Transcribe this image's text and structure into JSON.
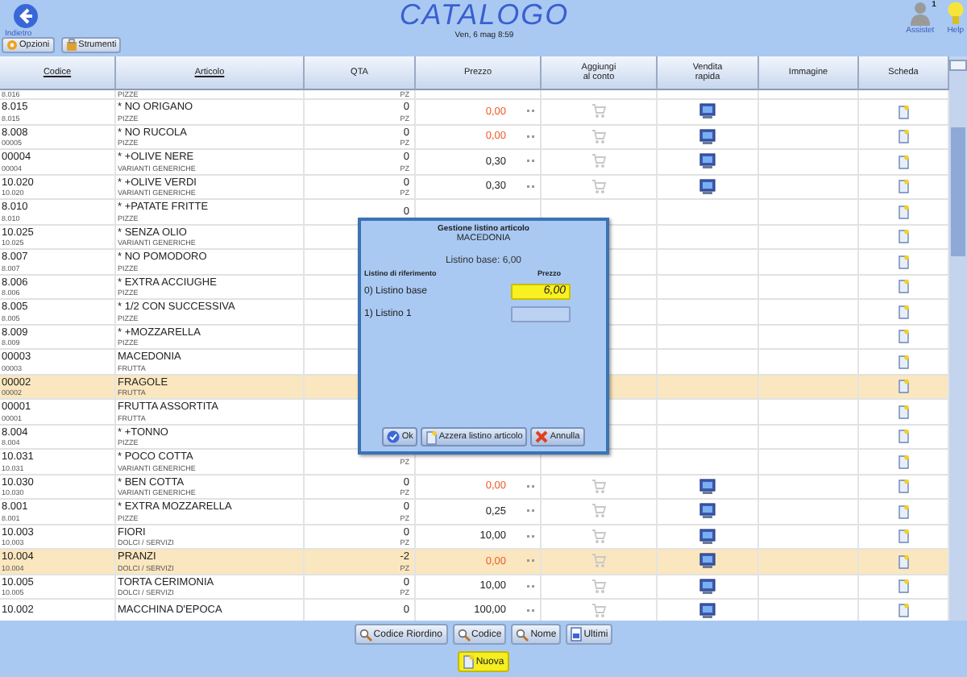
{
  "header": {
    "back_label": "Indietro",
    "title": "CATALOGO",
    "datetime": "Ven, 6 mag 8:59",
    "assistant_label": "Assistet",
    "assistant_badge": "1",
    "help_label": "Help"
  },
  "toolbar": [
    {
      "label": "Opzioni",
      "kind": "options"
    },
    {
      "label": "Strumenti",
      "kind": "tools"
    }
  ],
  "table": {
    "columns": [
      {
        "label": "Codice",
        "sortable": true
      },
      {
        "label": "Articolo",
        "sortable": true
      },
      {
        "label": "QTA",
        "sortable": false
      },
      {
        "label": "Prezzo",
        "sortable": false
      },
      {
        "label": "Aggiungi\nal conto",
        "sortable": false
      },
      {
        "label": "Vendita\nrapida",
        "sortable": false
      },
      {
        "label": "Immagine",
        "sortable": false
      },
      {
        "label": "Scheda",
        "sortable": false
      }
    ],
    "rows": [
      {
        "kind": "lower",
        "highlighted": false,
        "code_sub": "8.016",
        "category": "PIZZE",
        "unit": "PZ"
      },
      {
        "kind": "full",
        "highlighted": false,
        "code": "8.015",
        "code_sub": "8.015",
        "name": "* NO ORIGANO",
        "category": "PIZZE",
        "qty": "0",
        "unit": "PZ",
        "price": "0,00",
        "price_alert": true
      },
      {
        "kind": "full",
        "highlighted": false,
        "code": "8.008",
        "code_sub": "00005",
        "name": "* NO RUCOLA",
        "category": "PIZZE",
        "qty": "0",
        "unit": "PZ",
        "price": "0,00",
        "price_alert": true
      },
      {
        "kind": "full",
        "highlighted": false,
        "code": "00004",
        "code_sub": "00004",
        "name": "* +OLIVE NERE",
        "category": "VARIANTI GENERICHE",
        "qty": "0",
        "unit": "PZ",
        "price": "0,30",
        "price_alert": false
      },
      {
        "kind": "full",
        "highlighted": false,
        "code": "10.020",
        "code_sub": "10.020",
        "name": "* +OLIVE VERDI",
        "category": "VARIANTI GENERICHE",
        "qty": "0",
        "unit": "PZ",
        "price": "0,30",
        "price_alert": false
      },
      {
        "kind": "full",
        "highlighted": false,
        "code": "8.010",
        "code_sub": "8.010",
        "name": "* +PATATE FRITTE",
        "category": "PIZZE",
        "qty": "0"
      },
      {
        "kind": "full",
        "highlighted": false,
        "code": "10.025",
        "code_sub": "10.025",
        "name": "* SENZA OLIO",
        "category": "VARIANTI GENERICHE"
      },
      {
        "kind": "full",
        "highlighted": false,
        "code": "8.007",
        "code_sub": "8.007",
        "name": "* NO POMODORO",
        "category": "PIZZE"
      },
      {
        "kind": "full",
        "highlighted": false,
        "code": "8.006",
        "code_sub": "8.006",
        "name": "* EXTRA ACCIUGHE",
        "category": "PIZZE"
      },
      {
        "kind": "full",
        "highlighted": false,
        "code": "8.005",
        "code_sub": "8.005",
        "name": "* 1/2 CON SUCCESSIVA",
        "category": "PIZZE"
      },
      {
        "kind": "full",
        "highlighted": false,
        "code": "8.009",
        "code_sub": "8.009",
        "name": "* +MOZZARELLA",
        "category": "PIZZE"
      },
      {
        "kind": "full",
        "highlighted": false,
        "code": "00003",
        "code_sub": "00003",
        "name": "MACEDONIA",
        "category": "FRUTTA"
      },
      {
        "kind": "full",
        "highlighted": true,
        "code": "00002",
        "code_sub": "00002",
        "name": "FRAGOLE",
        "category": "FRUTTA"
      },
      {
        "kind": "full",
        "highlighted": false,
        "code": "00001",
        "code_sub": "00001",
        "name": "FRUTTA ASSORTITA",
        "category": "FRUTTA"
      },
      {
        "kind": "full",
        "highlighted": false,
        "code": "8.004",
        "code_sub": "8.004",
        "name": "* +TONNO",
        "category": "PIZZE"
      },
      {
        "kind": "full",
        "highlighted": false,
        "code": "10.031",
        "code_sub": "10.031",
        "name": "* POCO COTTA",
        "category": "VARIANTI GENERICHE",
        "unit": "PZ"
      },
      {
        "kind": "full",
        "highlighted": false,
        "code": "10.030",
        "code_sub": "10.030",
        "name": "* BEN COTTA",
        "category": "VARIANTI GENERICHE",
        "qty": "0",
        "unit": "PZ",
        "price": "0,00",
        "price_alert": true
      },
      {
        "kind": "full",
        "highlighted": false,
        "code": "8.001",
        "code_sub": "8.001",
        "name": "* EXTRA MOZZARELLA",
        "category": "PIZZE",
        "qty": "0",
        "unit": "PZ",
        "price": "0,25",
        "price_alert": false
      },
      {
        "kind": "full",
        "highlighted": false,
        "code": "10.003",
        "code_sub": "10.003",
        "name": "FIORI",
        "category": "DOLCI / SERVIZI",
        "qty": "0",
        "unit": "PZ",
        "price": "10,00",
        "price_alert": false
      },
      {
        "kind": "full",
        "highlighted": true,
        "code": "10.004",
        "code_sub": "10.004",
        "name": "PRANZI",
        "category": "DOLCI / SERVIZI",
        "qty": "-2",
        "unit": "PZ",
        "price": "0,00",
        "price_alert": true
      },
      {
        "kind": "full",
        "highlighted": false,
        "code": "10.005",
        "code_sub": "10.005",
        "name": "TORTA CERIMONIA",
        "category": "DOLCI / SERVIZI",
        "qty": "0",
        "unit": "PZ",
        "price": "10,00",
        "price_alert": false
      },
      {
        "kind": "upper",
        "highlighted": false,
        "code": "10.002",
        "name": "MACCHINA D'EPOCA",
        "qty": "0",
        "price": "100,00",
        "price_alert": false
      }
    ]
  },
  "dialog": {
    "title": "Gestione listino articolo",
    "item": "MACEDONIA",
    "base": "Listino base: 6,00",
    "list_heading": "Listino di riferimento",
    "price_heading": "Prezzo",
    "lists": [
      {
        "label": "0) Listino base",
        "value": "6,00",
        "focused": true
      },
      {
        "label": "1) Listino 1",
        "focused": false
      }
    ],
    "buttons": [
      {
        "label": "Ok",
        "kind": "ok"
      },
      {
        "label": "Azzera listino articolo",
        "kind": "reset"
      },
      {
        "label": "Annulla",
        "kind": "cancel"
      }
    ]
  },
  "bottom_buttons": [
    {
      "label": "Codice Riordino",
      "kind": "search"
    },
    {
      "label": "Codice",
      "kind": "search"
    },
    {
      "label": "Nome",
      "kind": "search"
    },
    {
      "label": "Ultimi",
      "kind": "recent"
    }
  ],
  "primary_button": "Nuova"
}
